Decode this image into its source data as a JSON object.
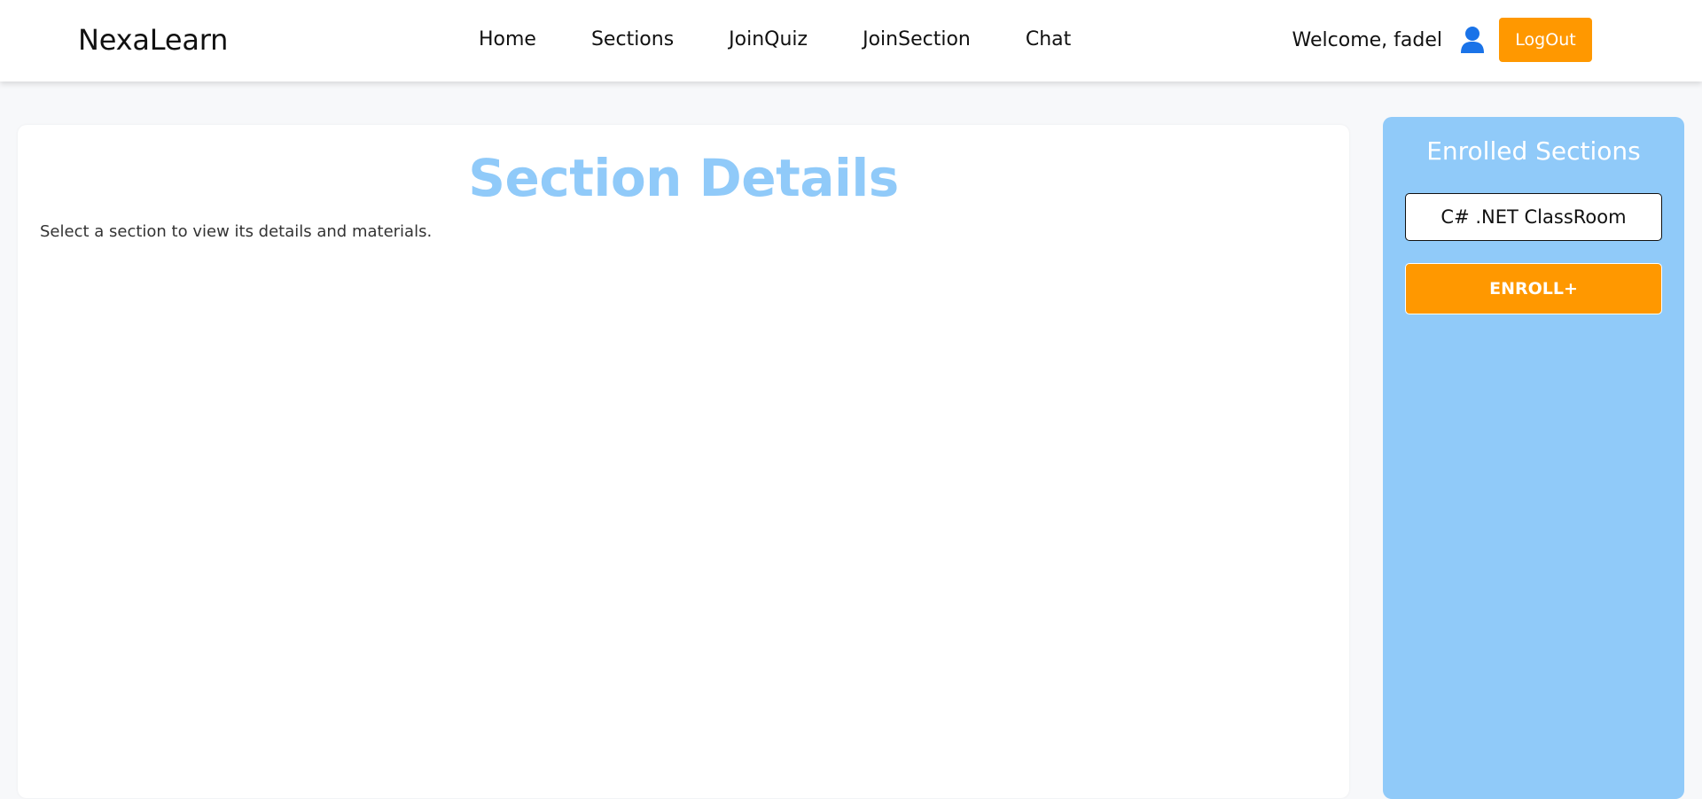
{
  "header": {
    "brand": "NexaLearn",
    "nav": [
      "Home",
      "Sections",
      "JoinQuiz",
      "JoinSection",
      "Chat"
    ],
    "welcome": "Welcome, fadel",
    "user_icon": "user-icon",
    "logout_label": "LogOut"
  },
  "main": {
    "title": "Section Details",
    "message": "Select a section to view its details and materials."
  },
  "sidebar": {
    "title": "Enrolled Sections",
    "sections": [
      "C# .NET ClassRoom"
    ],
    "enroll_label": "ENROLL+"
  },
  "colors": {
    "accent_orange": "#ff9800",
    "light_blue": "#90caf9",
    "page_background": "#f7f8fa",
    "user_icon": "#1a73e8"
  }
}
